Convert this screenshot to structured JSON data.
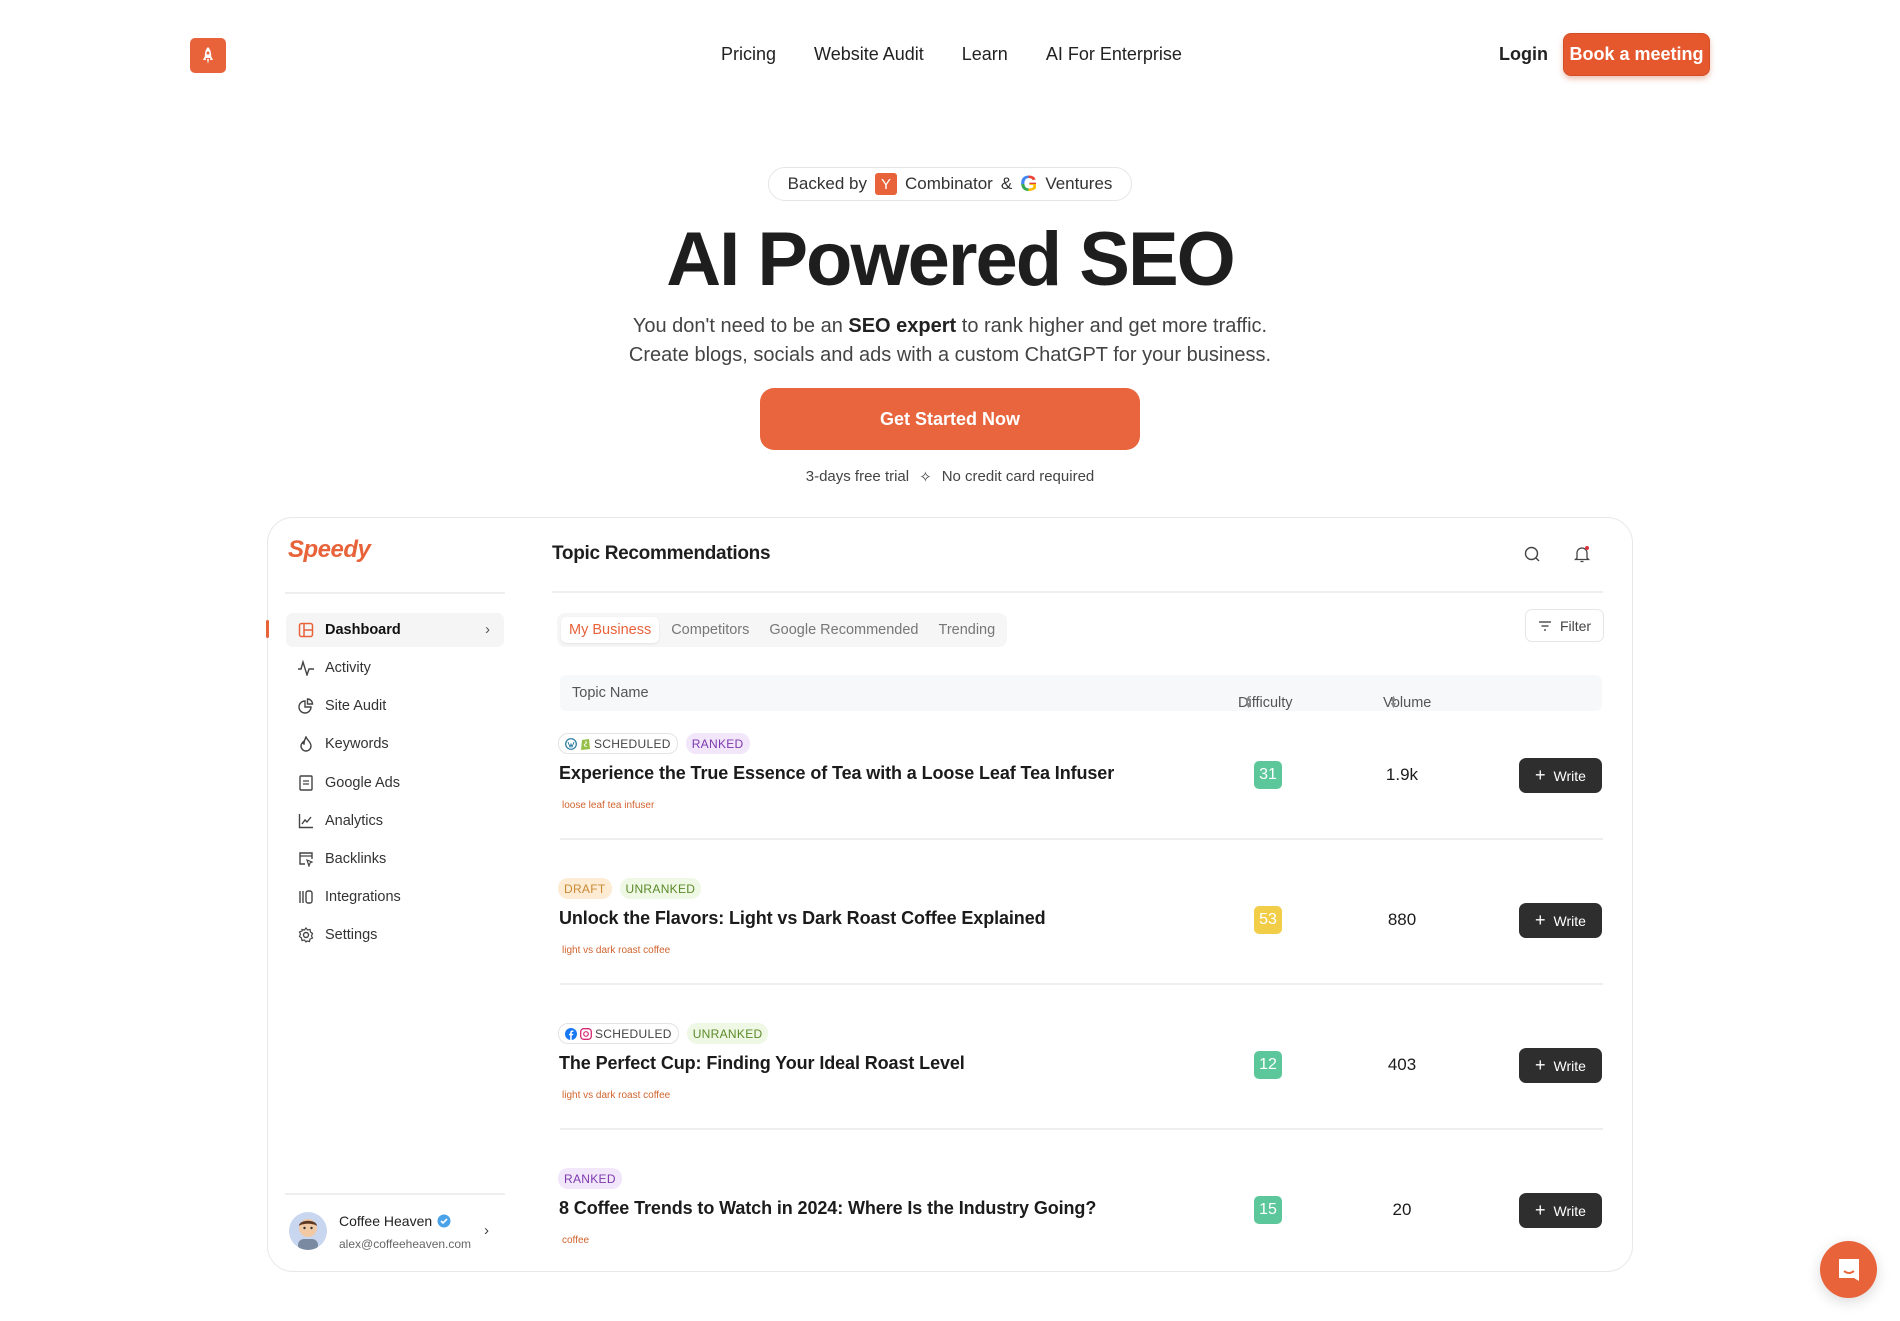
{
  "colors": {
    "brand": "#E8623A",
    "dark_button": "#2e2e2e",
    "difficulty_easy": "#5cc79a",
    "difficulty_medium": "#f2cd48"
  },
  "header": {
    "logo_icon": "rocket-icon",
    "nav": [
      "Pricing",
      "Website Audit",
      "Learn",
      "AI For Enterprise"
    ],
    "login": "Login",
    "book": "Book a meeting"
  },
  "hero": {
    "backed": {
      "prefix": "Backed by",
      "yc_letter": "Y",
      "yc": "Combinator",
      "amp": "&",
      "g_letter": "G",
      "google": "Ventures"
    },
    "title": "AI Powered SEO",
    "sub1_a": "You don't need to be an ",
    "sub1_b": "SEO expert",
    "sub1_c": " to rank higher and get more traffic.",
    "sub2": "Create blogs, socials and ads with a custom ChatGPT for your business.",
    "cta": "Get Started Now",
    "trial": "3-days free trial",
    "no_card": "No credit card required"
  },
  "app": {
    "brand": "Speedy",
    "sidebar": [
      {
        "label": "Dashboard",
        "icon": "layout-icon",
        "active": true
      },
      {
        "label": "Activity",
        "icon": "activity-icon"
      },
      {
        "label": "Site Audit",
        "icon": "pie-chart-icon"
      },
      {
        "label": "Keywords",
        "icon": "flame-icon"
      },
      {
        "label": "Google Ads",
        "icon": "document-icon"
      },
      {
        "label": "Analytics",
        "icon": "line-chart-icon"
      },
      {
        "label": "Backlinks",
        "icon": "link-cursor-icon"
      },
      {
        "label": "Integrations",
        "icon": "integrations-icon"
      },
      {
        "label": "Settings",
        "icon": "gear-icon"
      }
    ],
    "user": {
      "name": "Coffee Heaven",
      "email": "alex@coffeeheaven.com"
    },
    "main": {
      "title": "Topic Recommendations",
      "tabs": [
        "My Business",
        "Competitors",
        "Google Recommended",
        "Trending"
      ],
      "filter": "Filter",
      "columns": {
        "topic": "Topic Name",
        "difficulty": "Difficulty",
        "volume": "Volume"
      },
      "write": "Write",
      "rows": [
        {
          "badges": [
            {
              "type": "scheduled",
              "label": "SCHEDULED",
              "icons": [
                "wordpress",
                "shopify"
              ]
            },
            {
              "type": "ranked",
              "label": "RANKED"
            }
          ],
          "title": "Experience the True Essence of Tea with a Loose Leaf Tea Infuser",
          "keyword": "loose leaf tea infuser",
          "difficulty": "31",
          "level": "easy",
          "volume": "1.9k"
        },
        {
          "badges": [
            {
              "type": "draft",
              "label": "DRAFT"
            },
            {
              "type": "unranked",
              "label": "UNRANKED"
            }
          ],
          "title": "Unlock the Flavors: Light vs Dark Roast Coffee Explained",
          "keyword": "light vs dark roast coffee",
          "difficulty": "53",
          "level": "medium",
          "volume": "880"
        },
        {
          "badges": [
            {
              "type": "scheduled",
              "label": "SCHEDULED",
              "icons": [
                "facebook",
                "instagram"
              ]
            },
            {
              "type": "unranked",
              "label": "UNRANKED"
            }
          ],
          "title": "The Perfect Cup: Finding Your Ideal Roast Level",
          "keyword": "light vs dark roast coffee",
          "difficulty": "12",
          "level": "easy",
          "volume": "403"
        },
        {
          "badges": [
            {
              "type": "ranked",
              "label": "RANKED"
            }
          ],
          "title": "8 Coffee Trends to Watch in 2024: Where Is the Industry Going?",
          "keyword": "coffee",
          "difficulty": "15",
          "level": "easy",
          "volume": "20"
        }
      ]
    }
  }
}
